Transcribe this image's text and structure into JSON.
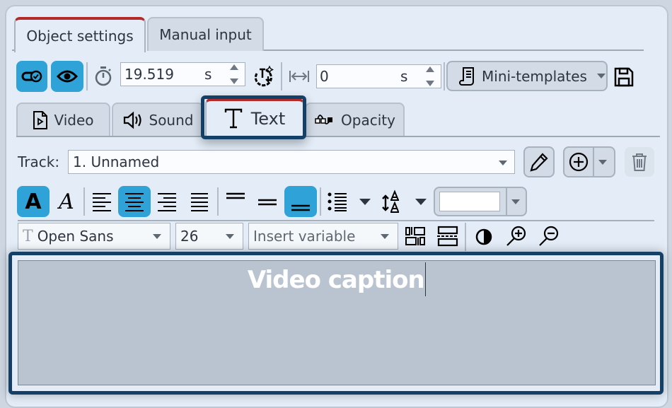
{
  "top_tabs": [
    {
      "label": "Object settings",
      "active": true
    },
    {
      "label": "Manual input",
      "active": false
    }
  ],
  "toolbar1": {
    "toggle_enabled_icon": "toggle-check-icon",
    "visibility_icon": "eye-icon",
    "duration_icon": "stopwatch-icon",
    "duration_value": "19.519",
    "duration_unit": "s",
    "auto_duration_icon": "timer-magic-icon",
    "offset_icon": "horizontal-arrows-icon",
    "offset_value": "0",
    "offset_unit": "s",
    "mini_templates_label": "Mini-templates",
    "save_icon": "floppy-disk-icon"
  },
  "sub_tabs": [
    {
      "label": "Video",
      "icon": "video-file-icon",
      "active": false
    },
    {
      "label": "Sound",
      "icon": "speaker-icon",
      "active": false
    },
    {
      "label": "Text",
      "icon": "text-T-icon",
      "active": true
    },
    {
      "label": "Opacity",
      "icon": "opacity-curve-icon",
      "active": false
    }
  ],
  "track": {
    "label": "Track:",
    "value": "1. Unnamed"
  },
  "format_toolbar": {
    "bold_active": true,
    "italic_active": false,
    "align": "center",
    "vertical_align": "bottom",
    "color_value": "#ffffff"
  },
  "font_toolbar": {
    "font_family": "Open Sans",
    "font_size": "26",
    "insert_variable_placeholder": "Insert variable"
  },
  "editor": {
    "text": "Video caption"
  },
  "colors": {
    "accent_blue": "#2fa3d7",
    "focus_ring": "#143f66",
    "active_tab_marker": "#b22a2a",
    "editor_bg": "#bac4d0"
  }
}
